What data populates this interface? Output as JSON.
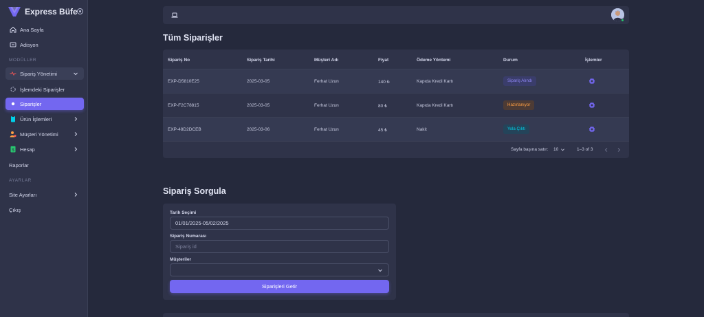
{
  "brand": {
    "name": "Express Büfe"
  },
  "sidebar": {
    "items": [
      {
        "label": "Ana Sayfa"
      },
      {
        "label": "Adisyon"
      }
    ],
    "section_modules": "MODÜLLER",
    "order_group": {
      "label": "Sipariş Yönetimi"
    },
    "order_sub": [
      {
        "label": "İşlemdeki Siparişler"
      },
      {
        "label": "Siparişler"
      }
    ],
    "module_items": [
      {
        "label": "Ürün İşlemleri"
      },
      {
        "label": "Müşteri Yönetimi"
      },
      {
        "label": "Hesap"
      },
      {
        "label": "Raporlar"
      }
    ],
    "section_account": "AYARLAR",
    "account_items": [
      {
        "label": "Site Ayarları"
      },
      {
        "label": "Çıkış"
      }
    ]
  },
  "orders": {
    "title": "Tüm Siparişler",
    "columns": [
      "Sipariş No",
      "Sipariş Tarihi",
      "Müşteri Adı",
      "Fiyat",
      "Ödeme Yöntemi",
      "Durum",
      "İşlemler"
    ],
    "rows": [
      {
        "no": "EXP-D5810E25",
        "date": "2025-03-05",
        "customer": "Ferhat Uzun",
        "price": "140 ₺",
        "payment": "Kapıda Kredi Kartı",
        "status": "Sipariş Alındı"
      },
      {
        "no": "EXP-F2C78815",
        "date": "2025-03-05",
        "customer": "Ferhat Uzun",
        "price": "80 ₺",
        "payment": "Kapıda Kredi Kartı",
        "status": "Hazırlanıyor"
      },
      {
        "no": "EXP-48D2DCEB",
        "date": "2025-03-06",
        "customer": "Ferhat Uzun",
        "price": "45 ₺",
        "payment": "Nakit",
        "status": "Yola Çıktı"
      }
    ],
    "status_colors": {
      "received": "#7367f0",
      "preparing": "#ff9f43",
      "shipped": "#00cfe8"
    },
    "footer": {
      "rows_per_page_label": "Sayfa başına satır:",
      "rows_per_page": "10",
      "range": "1–3 of 3"
    }
  },
  "query": {
    "title": "Sipariş Sorgula",
    "date_label": "Tarih Seçimi",
    "date_value": "01/01/2025-05/02/2025",
    "order_no_label": "Sipariş Numarası",
    "order_no_placeholder": "Sipariş id",
    "customers_label": "Müşteriler",
    "customers_value": "",
    "submit_label": "Siparişleri Getir"
  },
  "colors": {
    "accent": "#7367f0",
    "background": "#25293c",
    "card": "#2f3349"
  }
}
